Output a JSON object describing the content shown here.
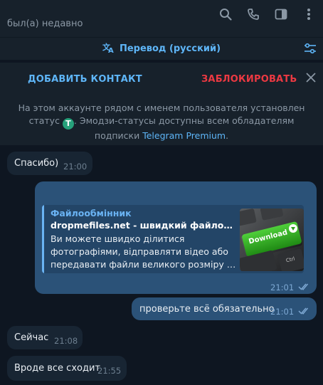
{
  "header": {
    "status": "был(а) недавно",
    "icons": [
      "search-icon",
      "phone-icon",
      "sidebar-toggle-icon",
      "more-vertical-icon"
    ]
  },
  "translate": {
    "label": "Перевод (русский)",
    "icon": "translate-icon",
    "settings_icon": "translate-settings-icon"
  },
  "actions": {
    "add_contact": "ДОБАВИТЬ КОНТАКТ",
    "block": "ЗАБЛОКИРОВАТЬ",
    "close_icon": "close-icon"
  },
  "notice": {
    "line1": "На этом аккаунте рядом с именем пользователя установлен статус",
    "emoji": "T",
    "line2": ". Эмодзи-статусы доступны всем обладателям подписки ",
    "link": "Telegram Premium",
    "end": "."
  },
  "messages": [
    {
      "direction": "in",
      "text": "Спасибо)",
      "time": "21:00"
    },
    {
      "direction": "out",
      "time": "21:01",
      "read": true,
      "preview": {
        "site": "Файлообмінник",
        "title": "dropmefiles.net - швидкий файлообмінник",
        "desc_lines": [
          "Ви можете швидко ділитися",
          "фотографіями, відправляти відео або",
          "передавати файли великого розміру (до"
        ],
        "thumb_key_label": "Download",
        "thumb_key2": "Ctrl"
      }
    },
    {
      "direction": "out",
      "text": "проверьте всё обязательно",
      "time": "21:01",
      "read": true
    },
    {
      "direction": "in",
      "text": "Сейчас",
      "time": "21:08"
    },
    {
      "direction": "in",
      "text": "Вроде все сходит",
      "time": "21:55"
    }
  ],
  "colors": {
    "background": "#0e1621",
    "panel": "#17212b",
    "incoming": "#182533",
    "outgoing": "#2b5278",
    "accent": "#5eb5f7",
    "danger": "#ec3942"
  }
}
